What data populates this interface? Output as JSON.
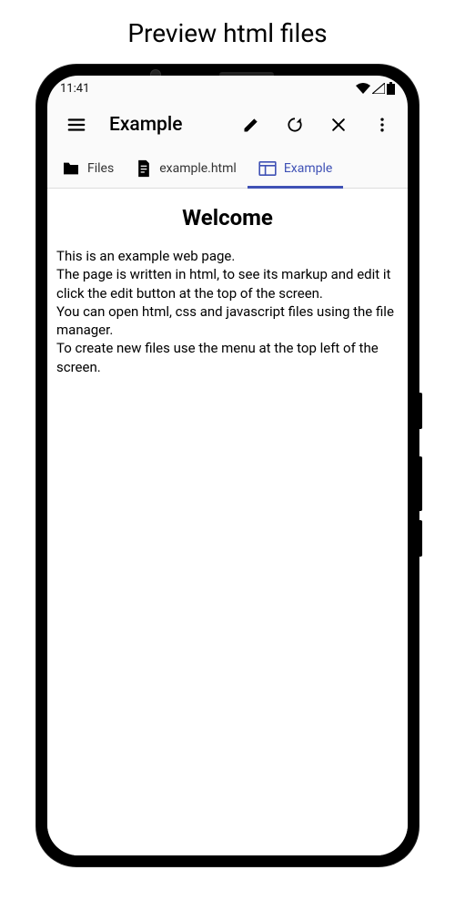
{
  "page_heading": "Preview html files",
  "status": {
    "time": "11:41"
  },
  "appbar": {
    "title": "Example"
  },
  "tabs": {
    "items": [
      {
        "label": "Files"
      },
      {
        "label": "example.html"
      },
      {
        "label": "Example"
      }
    ],
    "active_index": 2
  },
  "content": {
    "title": "Welcome",
    "body": "This is an example web page.\nThe page is written in html, to see its markup and edit it click the edit button at the top of the screen.\nYou can open html, css and javascript files using the file manager.\nTo create new files use the menu at the top left of the screen."
  },
  "colors": {
    "accent": "#3f51b5"
  }
}
